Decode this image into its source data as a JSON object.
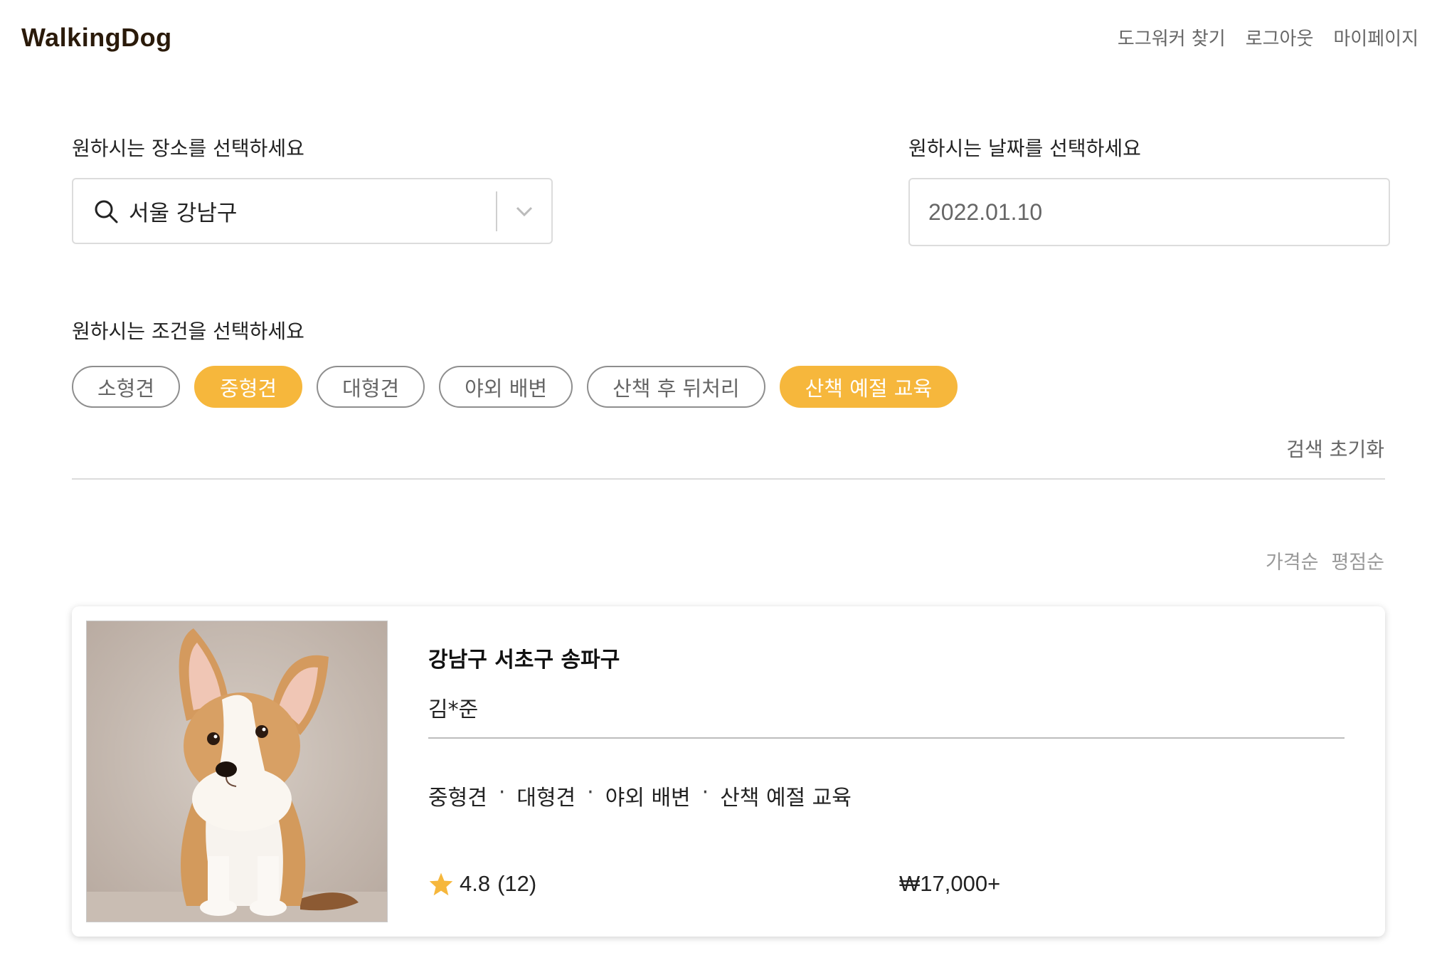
{
  "header": {
    "logo": "WalkingDog",
    "nav": [
      "도그워커 찾기",
      "로그아웃",
      "마이페이지"
    ]
  },
  "location": {
    "label": "원하시는 장소를 선택하세요",
    "value": "서울 강남구"
  },
  "date": {
    "label": "원하시는 날짜를 선택하세요",
    "value": "2022.01.10"
  },
  "conditions": {
    "label": "원하시는 조건을 선택하세요",
    "chips": [
      {
        "label": "소형견",
        "selected": false
      },
      {
        "label": "중형견",
        "selected": true
      },
      {
        "label": "대형견",
        "selected": false
      },
      {
        "label": "야외 배변",
        "selected": false
      },
      {
        "label": "산책 후 뒤처리",
        "selected": false
      },
      {
        "label": "산책 예절 교육",
        "selected": true
      }
    ],
    "reset": "검색 초기화"
  },
  "sort": {
    "options": [
      "가격순",
      "평점순"
    ]
  },
  "card": {
    "title": "강남구 서초구 송파구",
    "name": "김*준",
    "tags": [
      "중형견",
      "대형견",
      "야외 배변",
      "산책 예절 교육"
    ],
    "tag_separator": "·",
    "rating": "4.8",
    "reviews": "(12)",
    "price": "₩17,000+"
  },
  "colors": {
    "accent": "#f6b73c",
    "star": "#f6b73c"
  }
}
